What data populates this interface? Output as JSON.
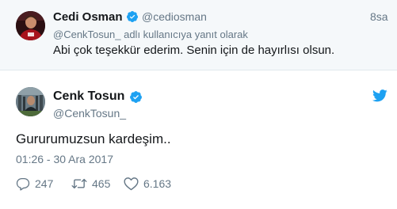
{
  "reply_tweet": {
    "author_name": "Cedi Osman",
    "handle": "@cediosman",
    "time": "8sa",
    "reply_context_mention": "@CenkTosun_",
    "reply_context_suffix": "adlı kullanıcıya yanıt olarak",
    "text": "Abi çok teşekkür ederim. Senin için de hayırlısı olsun."
  },
  "main_tweet": {
    "author_name": "Cenk Tosun",
    "handle": "@CenkTosun_",
    "text": "Gururumuzsun kardeşim..",
    "date": "01:26 - 30 Ara 2017",
    "replies": "247",
    "retweets": "465",
    "likes": "6.163"
  },
  "colors": {
    "twitter_blue": "#1da1f2",
    "secondary_text": "#657786",
    "reply_background": "#f5f8fa"
  },
  "icons": {
    "verified": "verified-badge-icon",
    "twitter": "twitter-bird-icon",
    "reply": "reply-icon",
    "retweet": "retweet-icon",
    "like": "heart-icon"
  }
}
